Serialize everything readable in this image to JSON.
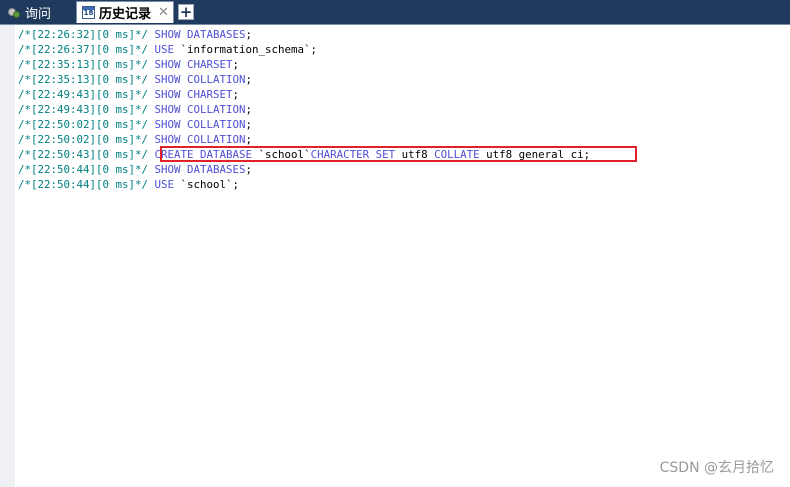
{
  "tabs": {
    "query_label": "询问",
    "history_label": "历史记录",
    "history_icon_text": "18",
    "close_glyph": "✕",
    "add_glyph": "+"
  },
  "history": [
    {
      "comment": "/*[22:26:32][0 ms]*/",
      "keyword": "SHOW DATABASES",
      "rest": ";"
    },
    {
      "comment": "/*[22:26:37][0 ms]*/",
      "keyword": "USE",
      "rest": " `information_schema`;"
    },
    {
      "comment": "/*[22:35:13][0 ms]*/",
      "keyword": "SHOW CHARSET",
      "rest": ";"
    },
    {
      "comment": "/*[22:35:13][0 ms]*/",
      "keyword": "SHOW COLLATION",
      "rest": ";"
    },
    {
      "comment": "/*[22:49:43][0 ms]*/",
      "keyword": "SHOW CHARSET",
      "rest": ";"
    },
    {
      "comment": "/*[22:49:43][0 ms]*/",
      "keyword": "SHOW COLLATION",
      "rest": ";"
    },
    {
      "comment": "/*[22:50:02][0 ms]*/",
      "keyword": "SHOW COLLATION",
      "rest": ";"
    },
    {
      "comment": "/*[22:50:02][0 ms]*/",
      "keyword": "SHOW COLLATION",
      "rest": ";"
    },
    {
      "comment": "/*[22:50:43][0 ms]*/",
      "segments": [
        {
          "t": "CREATE DATABASE",
          "k": true
        },
        {
          "t": " `school`",
          "k": false
        },
        {
          "t": "CHARACTER SET",
          "k": true
        },
        {
          "t": " utf8 ",
          "k": false
        },
        {
          "t": "COLLATE",
          "k": true
        },
        {
          "t": " utf8_general_ci;",
          "k": false
        }
      ]
    },
    {
      "comment": "/*[22:50:44][0 ms]*/",
      "keyword": "SHOW DATABASES",
      "rest": ";"
    },
    {
      "comment": "/*[22:50:44][0 ms]*/",
      "keyword": "USE",
      "rest": " `school`;"
    }
  ],
  "watermark": "CSDN @玄月拾忆",
  "colors": {
    "comment": "#008080",
    "keyword": "#4f4fd6",
    "highlight_border": "#e0202a",
    "tabbar": "#1f3a5c"
  }
}
